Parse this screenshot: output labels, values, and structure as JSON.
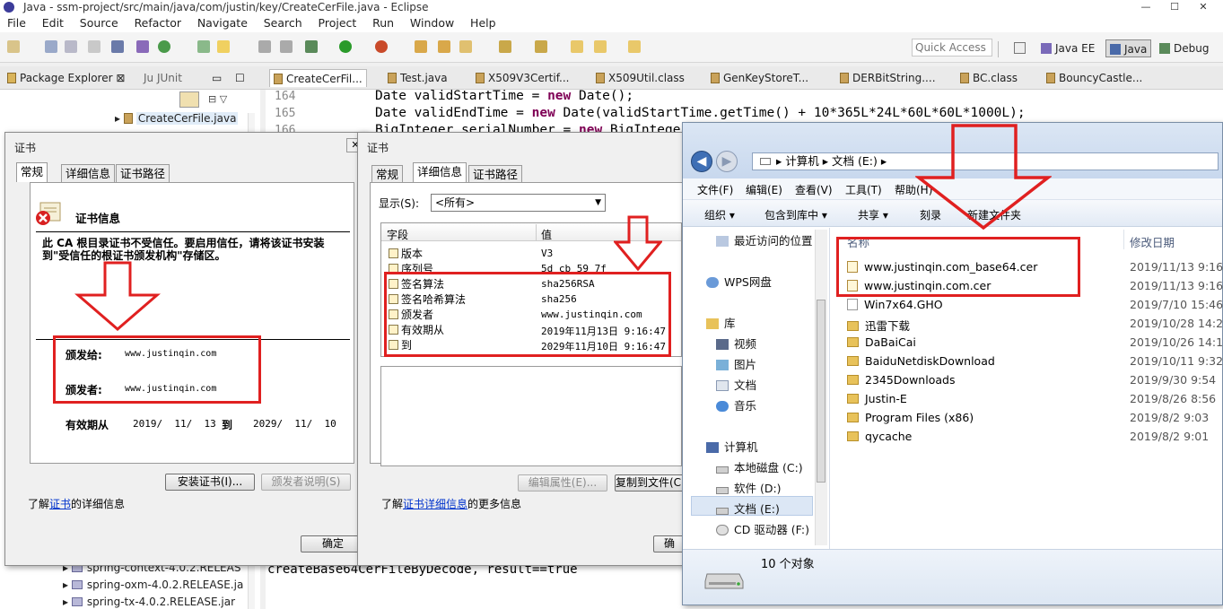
{
  "window": {
    "title": "Java - ssm-project/src/main/java/com/justin/key/CreateCerFile.java - Eclipse"
  },
  "menu": [
    "File",
    "Edit",
    "Source",
    "Refactor",
    "Navigate",
    "Search",
    "Project",
    "Run",
    "Window",
    "Help"
  ],
  "quick_access": "Quick Access",
  "perspectives": {
    "javaee": "Java EE",
    "java": "Java",
    "debug": "Debug"
  },
  "views": {
    "package_explorer": "Package Explorer",
    "junit": "JUnit"
  },
  "editor_tabs": [
    "CreateCerFil...",
    "Test.java",
    "X509V3Certif...",
    "X509Util.class",
    "GenKeyStoreT...",
    "DERBitString....",
    "BC.class",
    "BouncyCastle..."
  ],
  "editor": {
    "line1_no": "164",
    "line2_no": "165",
    "line3_no": "166",
    "line1": [
      "Date validStartTime = ",
      "new",
      " Date();"
    ],
    "line2": [
      "Date validEndTime = ",
      "new",
      " Date(validStartTime.getTime() + 10*365L*24L*60L*60L*1000L);"
    ],
    "line3": [
      "BigInteger serialNumber = ",
      "new",
      " BigInteger"
    ],
    "console": "createBase64CerFileByDecode, result==true"
  },
  "tree": {
    "file": "CreateCerFile.java",
    "jars": [
      "spring-context-4.0.2.RELEAS",
      "spring-oxm-4.0.2.RELEASE.ja",
      "spring-tx-4.0.2.RELEASE.jar"
    ]
  },
  "dialog1": {
    "title": "证书",
    "tabs": [
      "常规",
      "详细信息",
      "证书路径"
    ],
    "heading": "证书信息",
    "warning": "此 CA 根目录证书不受信任。要启用信任，请将该证书安装到\"受信任的根证书颁发机构\"存储区。",
    "issued_to_label": "颁发给:",
    "issued_to": "www.justinqin.com",
    "issued_by_label": "颁发者:",
    "issued_by": "www.justinqin.com",
    "valid_label": "有效期从",
    "valid_from": "2019/  11/  13",
    "valid_to_label": "到",
    "valid_to": "2029/  11/  10",
    "install_btn": "安装证书(I)...",
    "issuer_stmt_btn": "颁发者说明(S)",
    "learn_prefix": "了解",
    "learn_link": "证书",
    "learn_suffix": "的详细信息",
    "ok_btn": "确定"
  },
  "dialog2": {
    "title": "证书",
    "tabs": [
      "常规",
      "详细信息",
      "证书路径"
    ],
    "show_label": "显示(S):",
    "show_value": "<所有>",
    "col_field": "字段",
    "col_value": "值",
    "rows": [
      {
        "field": "版本",
        "value": "V3"
      },
      {
        "field": "序列号",
        "value": "5d cb 59 7f"
      },
      {
        "field": "签名算法",
        "value": "sha256RSA"
      },
      {
        "field": "签名哈希算法",
        "value": "sha256"
      },
      {
        "field": "颁发者",
        "value": "www.justinqin.com"
      },
      {
        "field": "有效期从",
        "value": "2019年11月13日 9:16:47"
      },
      {
        "field": "到",
        "value": "2029年11月10日 9:16:47"
      }
    ],
    "edit_btn": "编辑属性(E)...",
    "copy_btn": "复制到文件(C)...",
    "learn_prefix": "了解",
    "learn_link": "证书详细信息",
    "learn_suffix": "的更多信息",
    "ok_btn": "确"
  },
  "explorer": {
    "breadcrumb": [
      "计算机",
      "文档 (E:)"
    ],
    "menu": [
      "文件(F)",
      "编辑(E)",
      "查看(V)",
      "工具(T)",
      "帮助(H)"
    ],
    "toolbar": [
      "组织",
      "包含到库中",
      "共享",
      "刻录",
      "新建文件夹"
    ],
    "col_name": "名称",
    "col_date": "修改日期",
    "nav": {
      "recent": "最近访问的位置",
      "wps": "WPS网盘",
      "library": "库",
      "video": "视频",
      "pictures": "图片",
      "docs": "文档",
      "music": "音乐",
      "computer": "计算机",
      "drive_c": "本地磁盘 (C:)",
      "drive_d": "软件 (D:)",
      "drive_e": "文档 (E:)",
      "drive_f": "CD 驱动器 (F:)"
    },
    "files": [
      {
        "name": "www.justinqin.com_base64.cer",
        "date": "2019/11/13 9:16",
        "kind": "cert"
      },
      {
        "name": "www.justinqin.com.cer",
        "date": "2019/11/13 9:16",
        "kind": "cert"
      },
      {
        "name": "Win7x64.GHO",
        "date": "2019/7/10 15:46",
        "kind": "file"
      },
      {
        "name": "迅雷下载",
        "date": "2019/10/28 14:26",
        "kind": "folder"
      },
      {
        "name": "DaBaiCai",
        "date": "2019/10/26 14:18",
        "kind": "folder"
      },
      {
        "name": "BaiduNetdiskDownload",
        "date": "2019/10/11 9:32",
        "kind": "folder"
      },
      {
        "name": "2345Downloads",
        "date": "2019/9/30 9:54",
        "kind": "folder"
      },
      {
        "name": "Justin-E",
        "date": "2019/8/26 8:56",
        "kind": "folder"
      },
      {
        "name": "Program Files (x86)",
        "date": "2019/8/2 9:03",
        "kind": "folder"
      },
      {
        "name": "qycache",
        "date": "2019/8/2 9:01",
        "kind": "folder"
      }
    ],
    "status": "10 个对象"
  },
  "colors": {
    "annotation_red": "#e02020",
    "keyword": "#7f0055",
    "link": "#0033cc"
  }
}
